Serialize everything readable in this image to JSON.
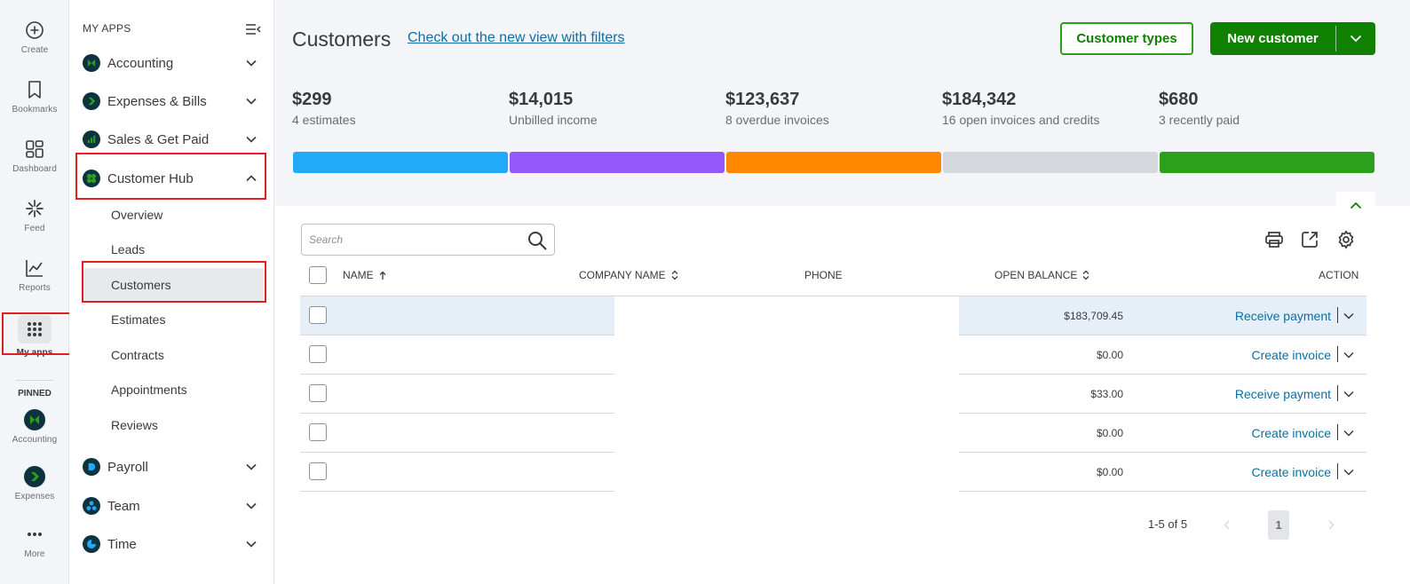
{
  "rail": {
    "items": [
      {
        "label": "Create",
        "icon": "plus-circle-icon"
      },
      {
        "label": "Bookmarks",
        "icon": "bookmark-icon"
      },
      {
        "label": "Dashboard",
        "icon": "dashboard-icon"
      },
      {
        "label": "Feed",
        "icon": "feed-icon"
      },
      {
        "label": "Reports",
        "icon": "reports-icon"
      },
      {
        "label": "My apps",
        "icon": "apps-grid-icon"
      }
    ],
    "pinned_label": "PINNED",
    "pinned": [
      {
        "label": "Accounting",
        "icon": "accounting-icon"
      },
      {
        "label": "Expenses",
        "icon": "expenses-icon"
      },
      {
        "label": "More",
        "icon": "more-icon"
      }
    ]
  },
  "apps": {
    "heading": "MY APPS",
    "groups": [
      {
        "label": "Accounting"
      },
      {
        "label": "Expenses & Bills"
      },
      {
        "label": "Sales & Get Paid"
      },
      {
        "label": "Customer Hub"
      },
      {
        "label": "Payroll"
      },
      {
        "label": "Team"
      },
      {
        "label": "Time"
      }
    ],
    "customer_hub_items": [
      "Overview",
      "Leads",
      "Customers",
      "Estimates",
      "Contracts",
      "Appointments",
      "Reviews"
    ],
    "active_item": "Customers"
  },
  "main": {
    "title": "Customers",
    "link": "Check out the new view with filters",
    "customer_types_button": "Customer types",
    "new_customer_button": "New customer",
    "stats": [
      {
        "amount": "$299",
        "caption": "4 estimates",
        "color": "#21abf6"
      },
      {
        "amount": "$14,015",
        "caption": "Unbilled income",
        "color": "#9457fa"
      },
      {
        "amount": "$123,637",
        "caption": "8 overdue invoices",
        "color": "#ff8800"
      },
      {
        "amount": "$184,342",
        "caption": "16 open invoices and credits",
        "color": "#d4d7dc"
      },
      {
        "amount": "$680",
        "caption": "3 recently paid",
        "color": "#2ca01c"
      }
    ],
    "search_placeholder": "Search",
    "table": {
      "headers": {
        "name": "NAME",
        "company": "COMPANY NAME",
        "phone": "PHONE",
        "balance": "OPEN BALANCE",
        "action": "ACTION"
      },
      "rows": [
        {
          "balance": "$183,709.45",
          "action": "Receive payment"
        },
        {
          "balance": "$0.00",
          "action": "Create invoice"
        },
        {
          "balance": "$33.00",
          "action": "Receive payment"
        },
        {
          "balance": "$0.00",
          "action": "Create invoice"
        },
        {
          "balance": "$0.00",
          "action": "Create invoice"
        }
      ]
    },
    "pager": {
      "count": "1-5 of 5",
      "page": "1"
    }
  }
}
